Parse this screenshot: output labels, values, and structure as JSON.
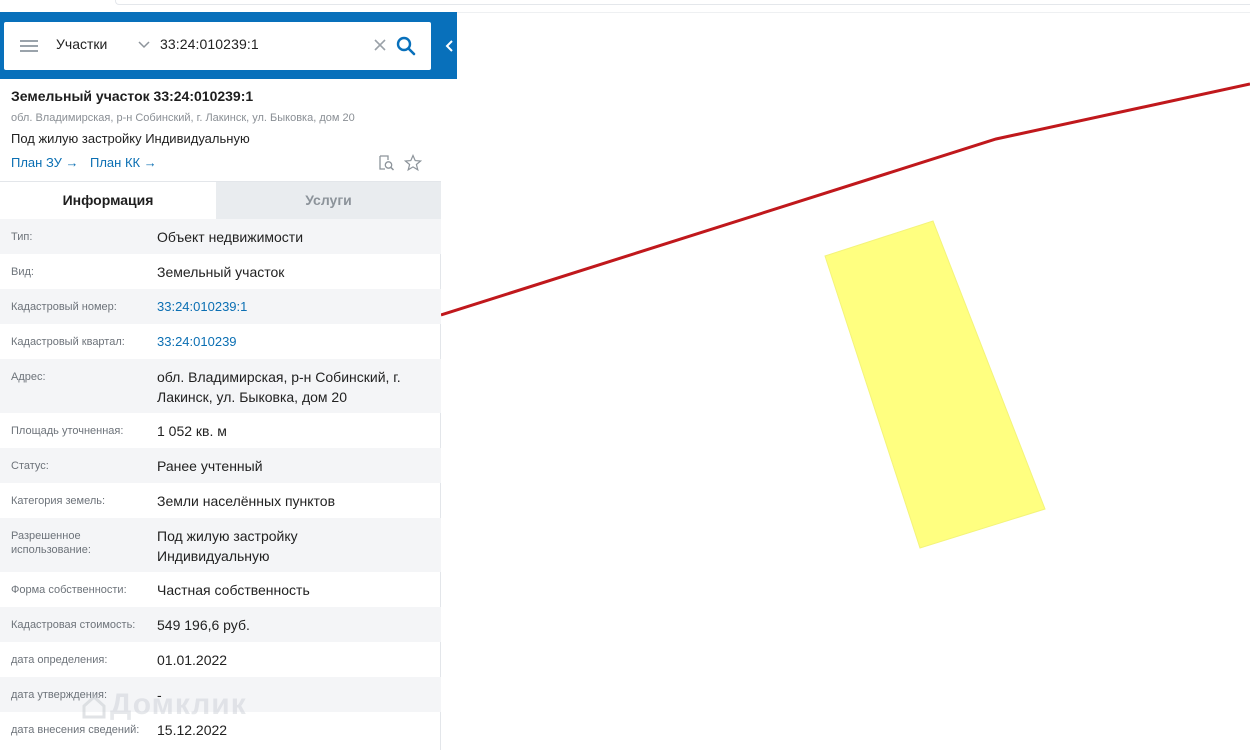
{
  "search": {
    "layer": "Участки",
    "value": "33:24:010239:1"
  },
  "summary": {
    "title": "Земельный участок 33:24:010239:1",
    "address": "обл. Владимирская, р-н Собинский, г. Лакинск, ул. Быковка, дом 20",
    "use": "Под жилую застройку Индивидуальную",
    "link_zu": "План ЗУ →",
    "link_kk": "План КК →"
  },
  "tabs": {
    "info": "Информация",
    "services": "Услуги"
  },
  "rows": [
    {
      "label": "Тип:",
      "value": "Объект недвижимости"
    },
    {
      "label": "Вид:",
      "value": "Земельный участок"
    },
    {
      "label": "Кадастровый номер:",
      "value": "33:24:010239:1"
    },
    {
      "label": "Кадастровый квартал:",
      "value": "33:24:010239"
    },
    {
      "label": "Адрес:",
      "value": "обл. Владимирская, р-н Собинский, г. Лакинск, ул. Быковка, дом 20"
    },
    {
      "label": "Площадь уточненная:",
      "value": "1 052 кв. м"
    },
    {
      "label": "Статус:",
      "value": "Ранее учтенный"
    },
    {
      "label": "Категория земель:",
      "value": "Земли населённых пунктов"
    },
    {
      "label": "Разрешенное использование:",
      "value": "Под жилую застройку Индивидуальную"
    },
    {
      "label": "Форма собственности:",
      "value": "Частная собственность"
    },
    {
      "label": "Кадастровая стоимость:",
      "value": "549 196,6 руб."
    },
    {
      "label": "дата определения:",
      "value": "01.01.2022"
    },
    {
      "label": "дата утверждения:",
      "value": "-"
    },
    {
      "label": "дата внесения сведений:",
      "value": "15.12.2022"
    }
  ],
  "watermark": "Домклик",
  "colors": {
    "brand_blue": "#0870bb",
    "link": "#0b6fb3",
    "boundary_line": "#c0181c",
    "parcel_fill": "#ffff80"
  }
}
